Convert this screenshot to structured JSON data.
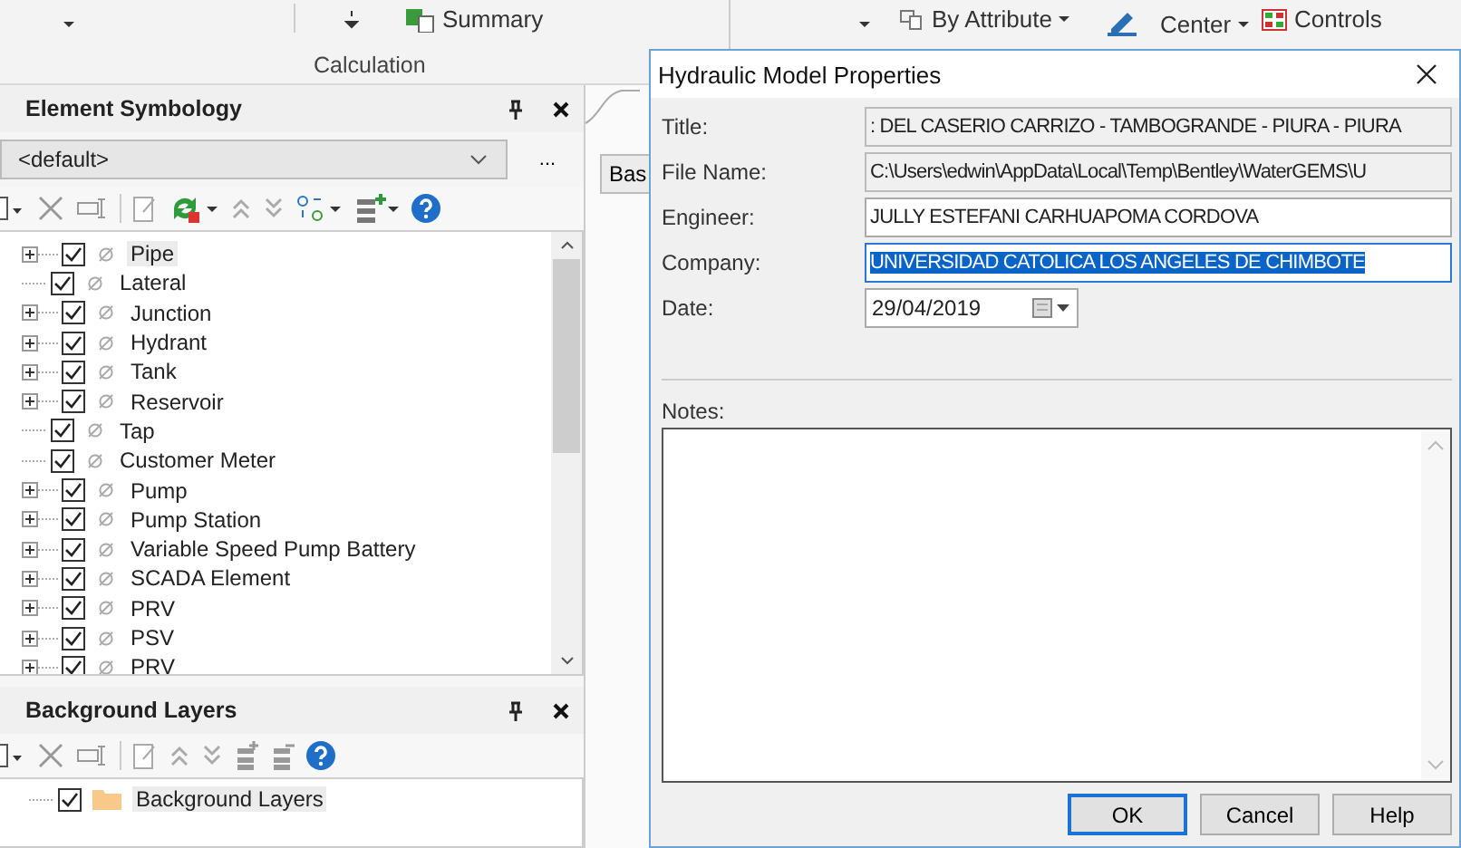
{
  "ribbon": {
    "summary": "Summary",
    "group_label": "Calculation",
    "by_attribute": "By Attribute",
    "center": "Center",
    "controls": "Controls"
  },
  "element_symbology": {
    "title": "Element Symbology",
    "profile": "<default>",
    "more": "...",
    "items": [
      {
        "label": "Pipe",
        "expandable": true,
        "checked": true,
        "selected": true
      },
      {
        "label": "Lateral",
        "expandable": false,
        "checked": true,
        "selected": false
      },
      {
        "label": "Junction",
        "expandable": true,
        "checked": true,
        "selected": false
      },
      {
        "label": "Hydrant",
        "expandable": true,
        "checked": true,
        "selected": false
      },
      {
        "label": "Tank",
        "expandable": true,
        "checked": true,
        "selected": false
      },
      {
        "label": "Reservoir",
        "expandable": true,
        "checked": true,
        "selected": false
      },
      {
        "label": "Tap",
        "expandable": false,
        "checked": true,
        "selected": false
      },
      {
        "label": "Customer Meter",
        "expandable": false,
        "checked": true,
        "selected": false
      },
      {
        "label": "Pump",
        "expandable": true,
        "checked": true,
        "selected": false
      },
      {
        "label": "Pump Station",
        "expandable": true,
        "checked": true,
        "selected": false
      },
      {
        "label": "Variable Speed Pump Battery",
        "expandable": true,
        "checked": true,
        "selected": false
      },
      {
        "label": "SCADA Element",
        "expandable": true,
        "checked": true,
        "selected": false
      },
      {
        "label": "PRV",
        "expandable": true,
        "checked": true,
        "selected": false
      },
      {
        "label": "PSV",
        "expandable": true,
        "checked": true,
        "selected": false
      },
      {
        "label": "PRV",
        "expandable": true,
        "checked": true,
        "selected": false
      }
    ]
  },
  "background_layers": {
    "title": "Background Layers",
    "items": [
      {
        "label": "Background Layers",
        "checked": true,
        "selected": true
      }
    ]
  },
  "side_tab": {
    "label": "Bas"
  },
  "dialog": {
    "title": "Hydraulic Model Properties",
    "fields": [
      {
        "label": "Title:",
        "value": ": DEL CASERIO CARRIZO - TAMBOGRANDE - PIURA - PIURA",
        "kind": "readonly",
        "selected": false
      },
      {
        "label": "File Name:",
        "value": "C:\\Users\\edwin\\AppData\\Local\\Temp\\Bentley\\WaterGEMS\\U",
        "kind": "readonly",
        "selected": false
      },
      {
        "label": "Engineer:",
        "value": "JULLY ESTEFANI CARHUAPOMA CORDOVA",
        "kind": "text",
        "selected": false
      },
      {
        "label": "Company:",
        "value": "UNIVERSIDAD CATOLICA LOS ANGELES DE CHIMBOTE",
        "kind": "text",
        "selected": true
      },
      {
        "label": "Date:",
        "value": "29/04/2019",
        "kind": "date",
        "selected": false
      }
    ],
    "notes_label": "Notes:",
    "buttons": [
      {
        "label": "OK",
        "default": true
      },
      {
        "label": "Cancel",
        "default": false
      },
      {
        "label": "Help",
        "default": false
      }
    ]
  }
}
